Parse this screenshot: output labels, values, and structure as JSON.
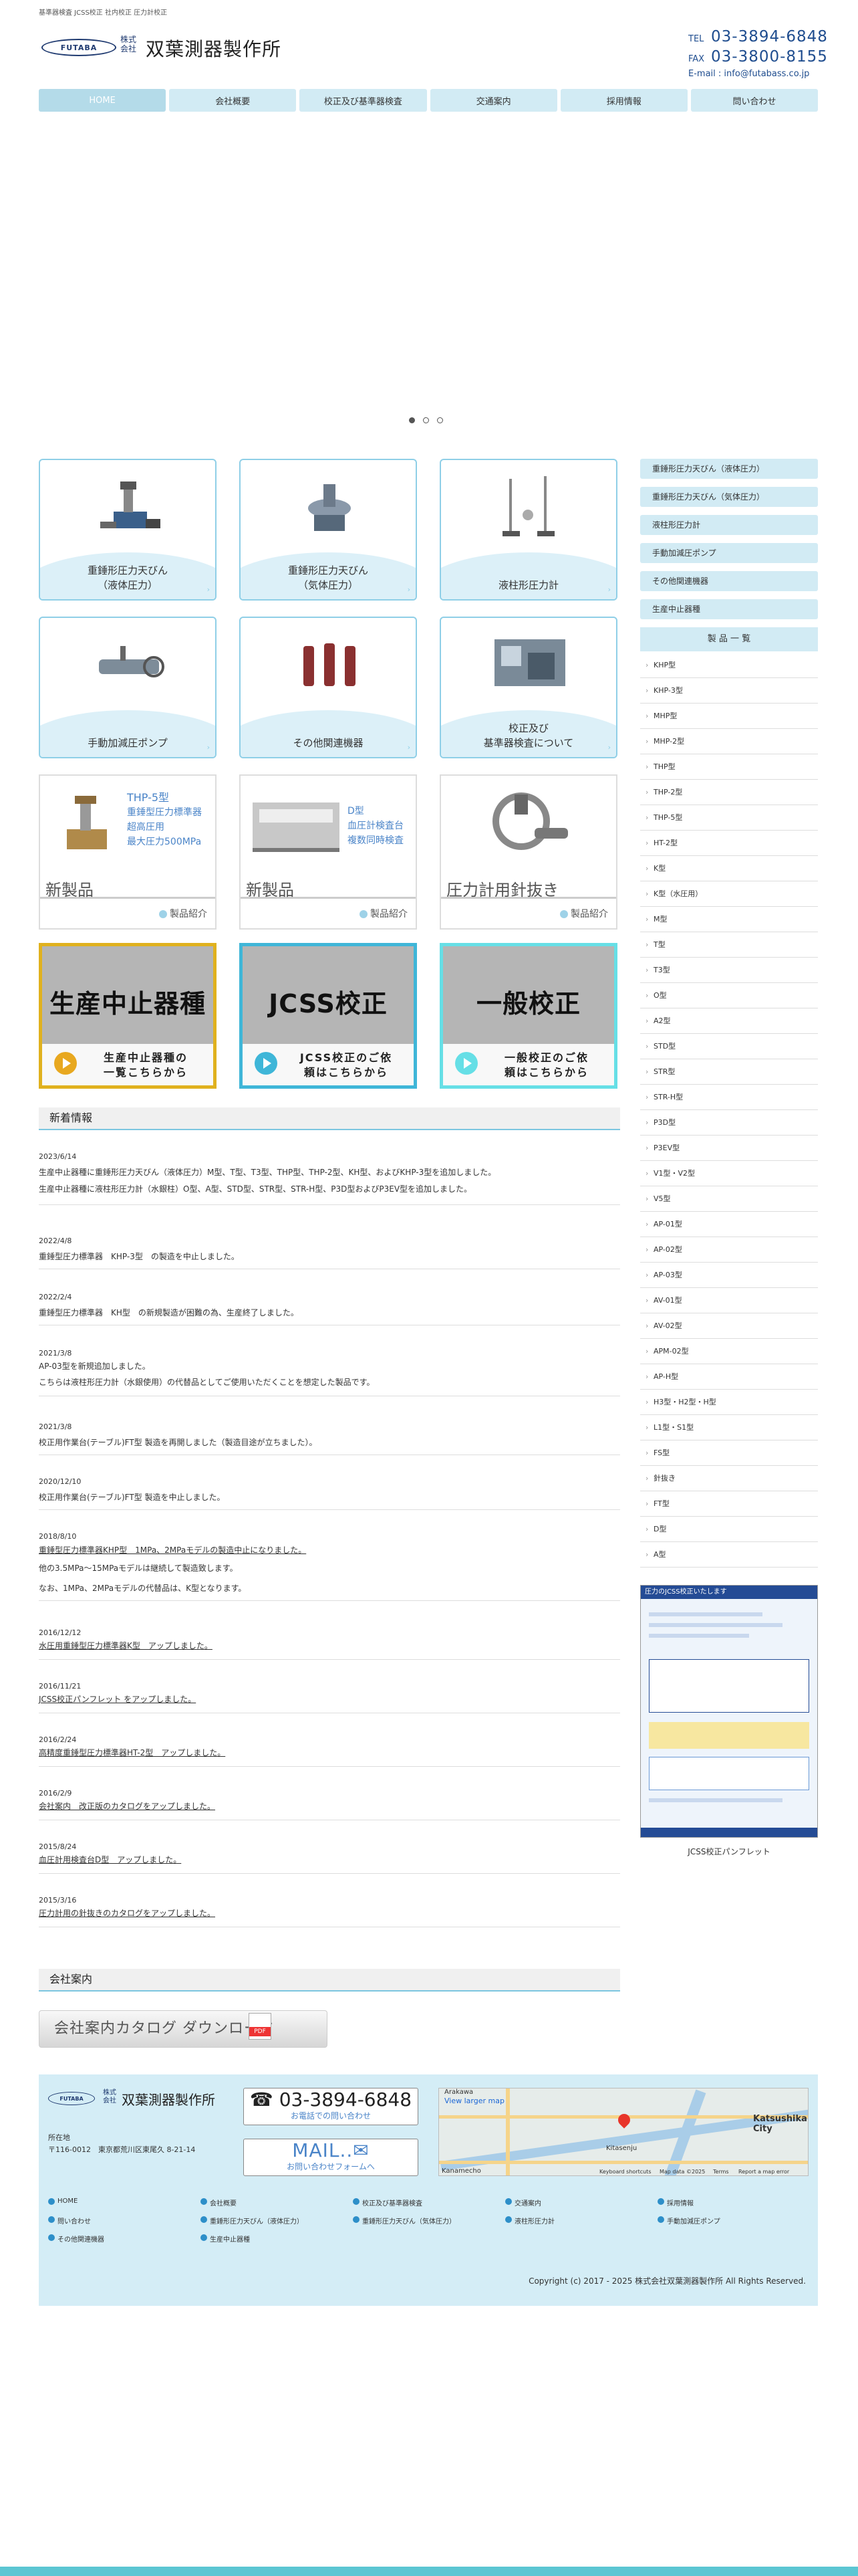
{
  "header": {
    "topnote": "基準器検査 JCSS校正 社内校正 圧力計校正",
    "logo_text": "FUTABA",
    "kk_line1": "株式",
    "kk_line2": "会社",
    "company_name": "双葉測器製作所",
    "tel_label": "TEL",
    "tel": "03-3894-6848",
    "fax_label": "FAX",
    "fax": "03-3800-8155",
    "email": "E-mail : info@futabass.co.jp"
  },
  "nav": [
    "HOME",
    "会社概要",
    "校正及び基準器検査",
    "交通案内",
    "採用情報",
    "問い合わせ"
  ],
  "products": [
    {
      "label1": "重錘形圧力天びん",
      "label2": "（液体圧力）"
    },
    {
      "label1": "重錘形圧力天びん",
      "label2": "（気体圧力）"
    },
    {
      "label1": "液柱形圧力計",
      "label2": ""
    },
    {
      "label1": "手動加減圧ポンプ",
      "label2": ""
    },
    {
      "label1": "その他関連機器",
      "label2": ""
    },
    {
      "label1": "校正及び",
      "label2": "基準器検査について"
    }
  ],
  "new_products": [
    {
      "title": "新製品",
      "link": "製品紹介",
      "desc": [
        "THP-5型",
        "重錘型圧力標準器",
        "超高圧用",
        "最大圧力500MPa"
      ]
    },
    {
      "title": "新製品",
      "link": "製品紹介",
      "desc": [
        "D型",
        "血圧計検査台",
        "複数同時検査"
      ]
    },
    {
      "title": "圧力計用針抜き",
      "link": "製品紹介",
      "desc": []
    }
  ],
  "banners": [
    {
      "big": "生産中止器種",
      "sub1": "生産中止器種の",
      "sub2": "一覧こちらから"
    },
    {
      "big": "JCSS校正",
      "sub1": "JCSS校正のご依",
      "sub2": "頼はこちらから"
    },
    {
      "big": "一般校正",
      "sub1": "一般校正のご依",
      "sub2": "頼はこちらから"
    }
  ],
  "news_heading": "新着情報",
  "news": [
    {
      "date": "2023/6/14",
      "lines": [
        "生産中止器種に重錘形圧力天びん（液体圧力）M型、T型、T3型、THP型、THP-2型、KH型、およびKHP-3型を追加しました。",
        "生産中止器種に液柱形圧力計（水銀柱）O型、A型、STD型、STR型、STR-H型、P3D型およびP3EV型を追加しました。"
      ],
      "link": false
    },
    {
      "date": "2022/4/8",
      "lines": [
        "重錘型圧力標準器　KHP-3型　の製造を中止しました。"
      ],
      "link": false
    },
    {
      "date": "2022/2/4",
      "lines": [
        "重錘型圧力標準器　KH型　の新規製造が困難の為、生産終了しました。"
      ],
      "link": false
    },
    {
      "date": "2021/3/8",
      "lines": [
        "AP-03型を新規追加しました。",
        "こちらは液柱形圧力計（水銀使用）の代替品としてご使用いただくことを想定した製品です。"
      ],
      "link": false
    },
    {
      "date": "2021/3/8",
      "lines": [
        "校正用作業台(テーブル)FT型 製造を再開しました（製造目途が立ちました）。"
      ],
      "link": false
    },
    {
      "date": "2020/12/10",
      "lines": [
        "校正用作業台(テーブル)FT型 製造を中止しました。"
      ],
      "link": false
    },
    {
      "date": "2018/8/10",
      "lines": [
        "重錘型圧力標準器KHP型　1MPa、2MPaモデルの製造中止になりました。",
        "他の3.5MPa〜15MPaモデルは継続して製造致します。",
        "なお、1MPa、2MPaモデルの代替品は、K型となります。"
      ],
      "link": true
    },
    {
      "date": "2016/12/12",
      "lines": [
        "水圧用重錘型圧力標準器K型　アップしました。"
      ],
      "link": true
    },
    {
      "date": "2016/11/21",
      "lines": [
        "JCSS校正パンフレット をアップしました。"
      ],
      "link": true
    },
    {
      "date": "2016/2/24",
      "lines": [
        "高精度重錘型圧力標準器HT-2型　アップしました。"
      ],
      "link": true
    },
    {
      "date": "2016/2/9",
      "lines": [
        "会社案内　改正版のカタログをアップしました。"
      ],
      "link": true
    },
    {
      "date": "2015/8/24",
      "lines": [
        "血圧計用検査台D型　アップしました。"
      ],
      "link": true
    },
    {
      "date": "2015/3/16",
      "lines": [
        "圧力計用の針抜きのカタログをアップしました。"
      ],
      "link": true
    }
  ],
  "company_heading": "会社案内",
  "catalog_button": "会社案内カタログ ダウンロード",
  "sidebar": {
    "cats": [
      "重錘形圧力天びん（液体圧力）",
      "重錘形圧力天びん（気体圧力）",
      "液柱形圧力計",
      "手動加減圧ポンプ",
      "その他関連機器",
      "生産中止器種"
    ],
    "product_heading": "製 品 一 覧",
    "product_list": [
      "KHP型",
      "KHP-3型",
      "MHP型",
      "MHP-2型",
      "THP型",
      "THP-2型",
      "THP-5型",
      "HT-2型",
      "K型",
      "K型（水圧用）",
      "M型",
      "T型",
      "T3型",
      "O型",
      "A2型",
      "STD型",
      "STR型",
      "STR-H型",
      "P3D型",
      "P3EV型",
      "V1型・V2型",
      "V5型",
      "AP-01型",
      "AP-02型",
      "AP-03型",
      "AV-01型",
      "AV-02型",
      "APM-02型",
      "AP-H型",
      "H3型・H2型・H型",
      "L1型・S1型",
      "FS型",
      "針抜き",
      "FT型",
      "D型",
      "A型"
    ],
    "pamphlet_caption": "JCSS校正パンフレット",
    "pamphlet_title": "圧力のJCSS校正いたします"
  },
  "footer": {
    "logo_text": "FUTABA",
    "kk_line1": "株式",
    "kk_line2": "会社",
    "company_name": "双葉測器製作所",
    "addr_label": "所在地",
    "addr": "〒116-0012　東京都荒川区東尾久 8-21-14",
    "tel": "☎ 03-3894-6848",
    "tel_sub": "お電話での問い合わせ",
    "mail": "MAIL..✉",
    "mail_sub": "お問い合わせフォームへ",
    "map_link": "View larger map",
    "map_labels": [
      "Arakawa",
      "Kitasenju",
      "Katsushika City",
      "Kanamecho",
      "Keyboard shortcuts",
      "Map data ©2025",
      "Terms",
      "Report a map error"
    ],
    "links": [
      "HOME",
      "会社概要",
      "校正及び基準器検査",
      "交通案内",
      "採用情報",
      "問い合わせ",
      "重錘形圧力天びん（液体圧力）",
      "重錘形圧力天びん（気体圧力）",
      "液柱形圧力計",
      "手動加減圧ポンプ",
      "その他関連機器",
      "生産中止器種"
    ],
    "copyright": "Copyright (c) 2017 - 2025 株式会社双葉測器製作所 All Rights Reserved."
  },
  "colors": {
    "accent": "#7cc6e0",
    "nav_bg": "#d2ebf4",
    "brand": "#1f3a70"
  }
}
